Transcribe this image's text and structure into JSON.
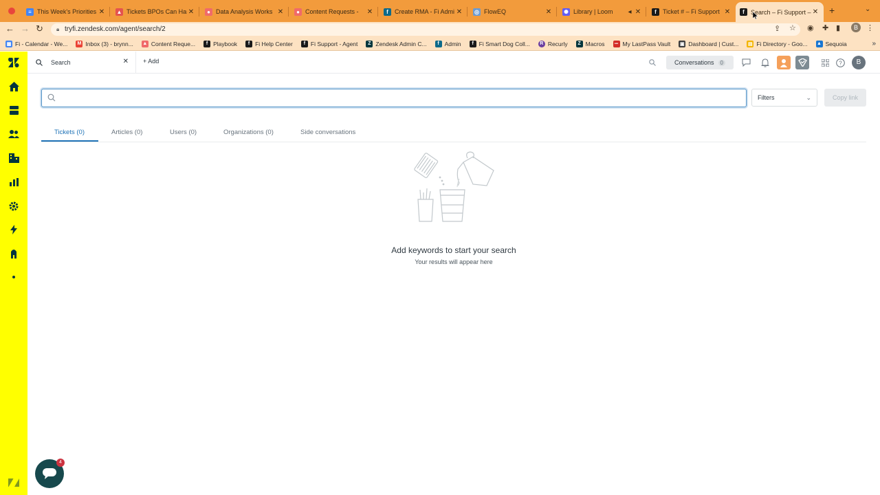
{
  "browser": {
    "tabs": [
      {
        "title": "This Week's Priorities",
        "color": "#4285f4",
        "glyph": "≡"
      },
      {
        "title": "Tickets BPOs Can Han",
        "color": "#e4534f",
        "glyph": "▲"
      },
      {
        "title": "Data Analysis Works",
        "color": "#f06a6a",
        "glyph": "●"
      },
      {
        "title": "Content Requests -",
        "color": "#f06a6a",
        "glyph": "●"
      },
      {
        "title": "Create RMA - Fi Admi",
        "color": "#0e6a8a",
        "glyph": "f"
      },
      {
        "title": "FlowEQ",
        "color": "#6c9bd2",
        "glyph": "◎"
      },
      {
        "title": "Library | Loom",
        "color": "#625df5",
        "glyph": "✺"
      },
      {
        "title": "Ticket # – Fi Support",
        "color": "#1a1a1a",
        "glyph": "f"
      },
      {
        "title": "Search – Fi Support –",
        "color": "#1a1a1a",
        "glyph": "f"
      }
    ],
    "url": "tryfi.zendesk.com/agent/search/2",
    "bookmarks": [
      {
        "label": "Fi - Calendar - We...",
        "color": "#4285f4",
        "glyph": "▦"
      },
      {
        "label": "Inbox (3) - brynn...",
        "color": "#ea4335",
        "glyph": "M"
      },
      {
        "label": "Content Reque...",
        "color": "#f06a6a",
        "glyph": "▲"
      },
      {
        "label": "Playbook",
        "color": "#1a1a1a",
        "glyph": "f"
      },
      {
        "label": "Fi Help Center",
        "color": "#1a1a1a",
        "glyph": "f"
      },
      {
        "label": "Fi Support - Agent",
        "color": "#1a1a1a",
        "glyph": "f"
      },
      {
        "label": "Zendesk Admin C...",
        "color": "#03363d",
        "glyph": "Z"
      },
      {
        "label": "Admin",
        "color": "#0e6a8a",
        "glyph": "f"
      },
      {
        "label": "Fi Smart Dog Coll...",
        "color": "#1a1a1a",
        "glyph": "f"
      },
      {
        "label": "Recurly",
        "color": "#6b3fa0",
        "glyph": "R"
      },
      {
        "label": "Macros",
        "color": "#03363d",
        "glyph": "Z"
      },
      {
        "label": "My LastPass Vault",
        "color": "#d32d27",
        "glyph": "•••"
      },
      {
        "label": "Dashboard | Cust...",
        "color": "#3b3b3b",
        "glyph": "▣"
      },
      {
        "label": "Fi Directory - Goo...",
        "color": "#f4b400",
        "glyph": "▤"
      },
      {
        "label": "Sequoia",
        "color": "#1976d2",
        "glyph": "▲"
      }
    ]
  },
  "topbar": {
    "search_tab_label": "Search",
    "add_label": "Add",
    "conversations_label": "Conversations",
    "conversations_count": "0",
    "avatar_initial": "B",
    "profile_initial": "B"
  },
  "search": {
    "value": "",
    "filters_label": "Filters",
    "copy_link_label": "Copy link"
  },
  "result_tabs": [
    {
      "label": "Tickets (0)"
    },
    {
      "label": "Articles (0)"
    },
    {
      "label": "Users (0)"
    },
    {
      "label": "Organizations (0)"
    },
    {
      "label": "Side conversations"
    }
  ],
  "empty_state": {
    "title": "Add keywords to start your search",
    "subtitle": "Your results will appear here"
  },
  "chat": {
    "badge": "4"
  },
  "colors": {
    "nav_bg": "#ffff00",
    "tab_strip": "#f29b3c",
    "accent": "#1f73b7"
  }
}
